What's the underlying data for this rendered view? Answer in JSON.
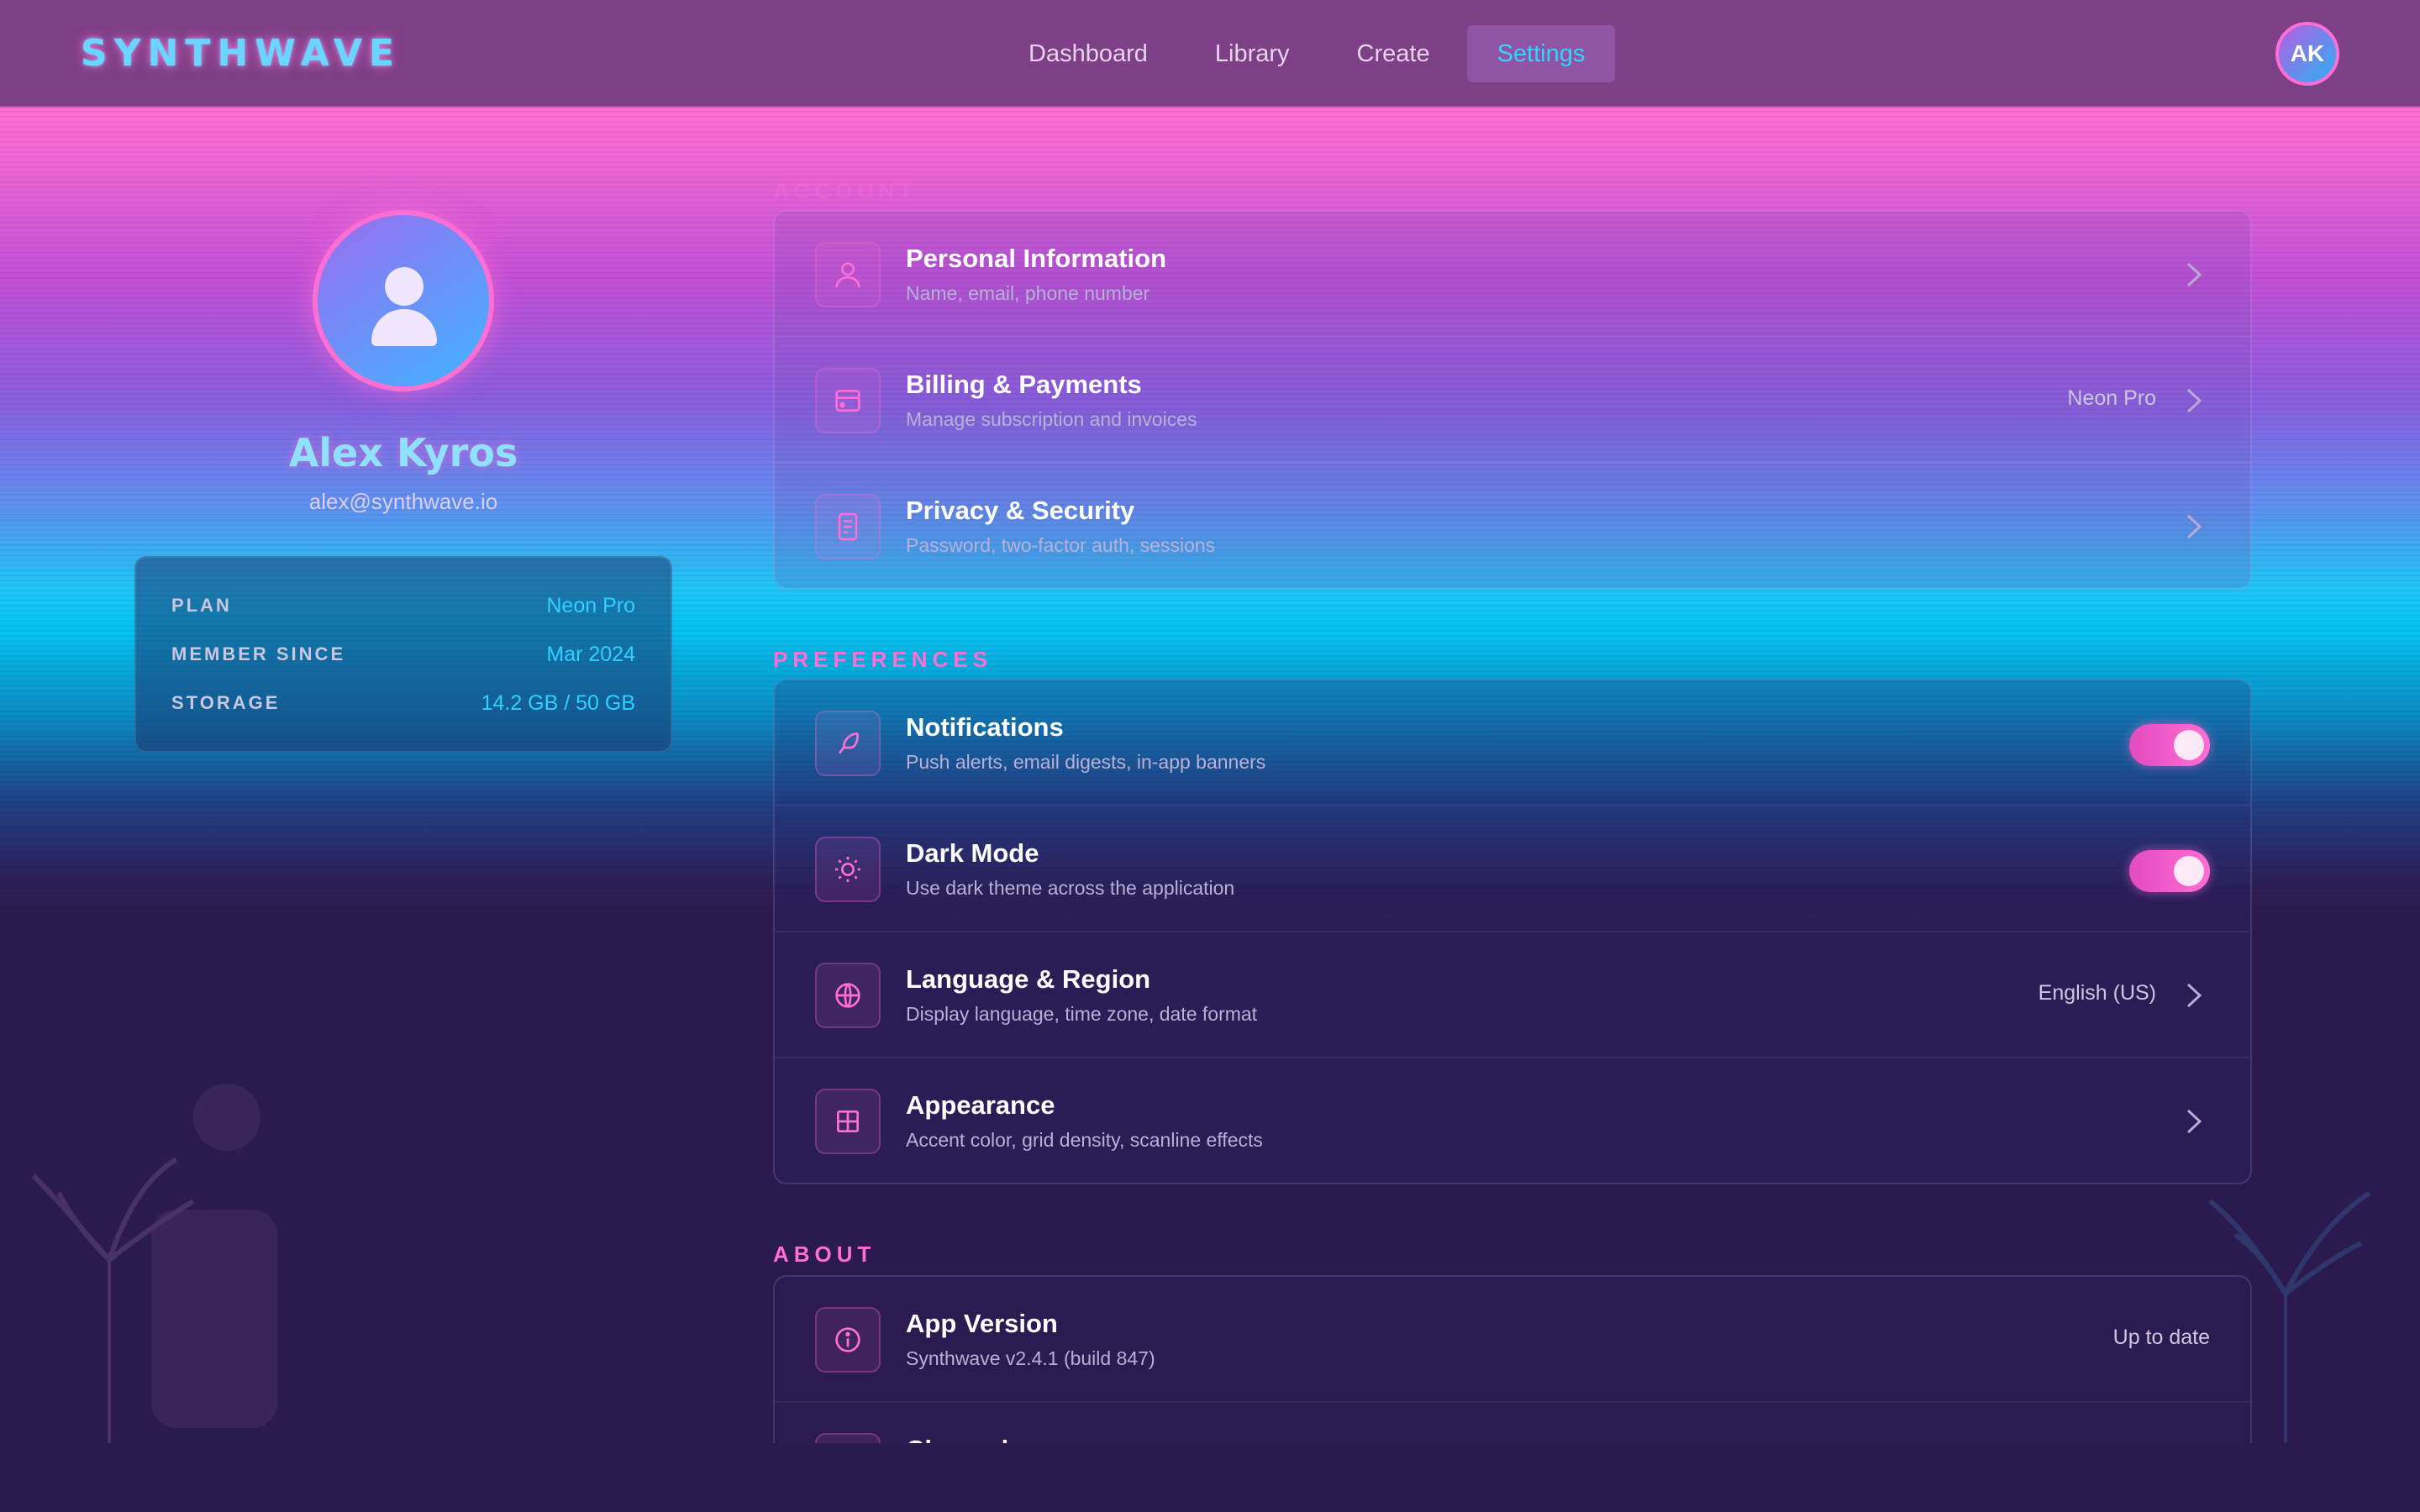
{
  "app": {
    "logo": "SYNTHWAVE"
  },
  "nav": {
    "tabs": [
      {
        "label": "Dashboard",
        "active": false
      },
      {
        "label": "Library",
        "active": false
      },
      {
        "label": "Create",
        "active": false
      },
      {
        "label": "Settings",
        "active": true
      }
    ],
    "user_initials": "AK"
  },
  "profile": {
    "name": "Alex Kyros",
    "email": "alex@synthwave.io",
    "stats": [
      {
        "label": "PLAN",
        "value": "Neon Pro"
      },
      {
        "label": "MEMBER SINCE",
        "value": "Mar 2024"
      },
      {
        "label": "STORAGE",
        "value": "14.2 GB / 50 GB"
      }
    ]
  },
  "sections": {
    "account": {
      "label": "ACCOUNT",
      "items": [
        {
          "title": "Personal Information",
          "subtitle": "Name, email, phone number",
          "icon": "user-icon",
          "value": ""
        },
        {
          "title": "Billing & Payments",
          "subtitle": "Manage subscription and invoices",
          "icon": "credit-card-icon",
          "value": "Neon Pro"
        },
        {
          "title": "Privacy & Security",
          "subtitle": "Password, two-factor auth, sessions",
          "icon": "document-lock-icon",
          "value": ""
        }
      ]
    },
    "preferences": {
      "label": "PREFERENCES",
      "items": [
        {
          "title": "Notifications",
          "subtitle": "Push alerts, email digests, in-app banners",
          "icon": "feather-icon",
          "toggle": true
        },
        {
          "title": "Dark Mode",
          "subtitle": "Use dark theme across the application",
          "icon": "sun-icon",
          "toggle": true
        },
        {
          "title": "Language & Region",
          "subtitle": "Display language, time zone, date format",
          "icon": "globe-icon",
          "value": "English (US)"
        },
        {
          "title": "Appearance",
          "subtitle": "Accent color, grid density, scanline effects",
          "icon": "grid-icon",
          "value": ""
        }
      ]
    },
    "about": {
      "label": "ABOUT",
      "items": [
        {
          "title": "App Version",
          "subtitle": "Synthwave v2.4.1 (build 847)",
          "icon": "info-icon",
          "value": "Up to date"
        },
        {
          "title": "Changelog",
          "subtitle": "",
          "icon": "document-icon",
          "value": ""
        }
      ]
    }
  },
  "colors": {
    "accent_pink": "#ff6ed4",
    "accent_cyan": "#2fd0ff",
    "bg": "#2b1a4d"
  }
}
